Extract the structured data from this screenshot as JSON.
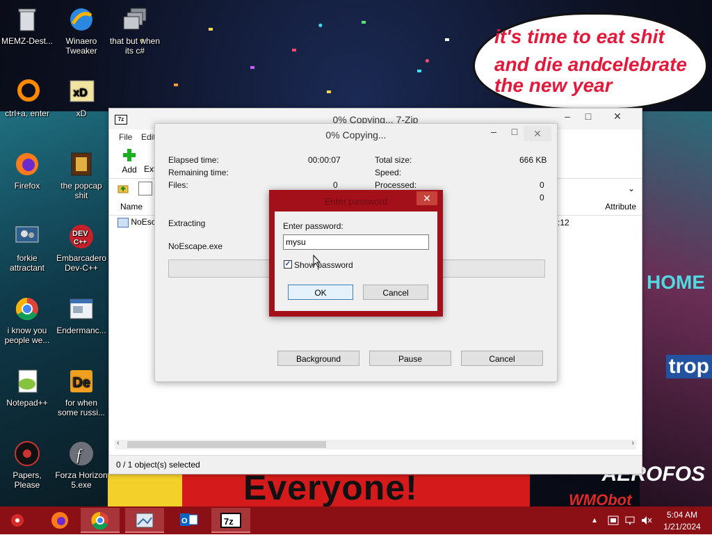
{
  "desktop": {
    "icons": [
      {
        "label": "MEMZ-Dest...",
        "icon": "recycle-bin-icon"
      },
      {
        "label": "Winaero Tweaker",
        "icon": "winaero-icon"
      },
      {
        "label": "that but when its c#",
        "icon": "stacked-windows-icon"
      },
      {
        "label": "ctrl+a, enter",
        "icon": "orange-ring-icon"
      },
      {
        "label": "xD",
        "icon": "hxd-icon"
      },
      {
        "label": "Firefox",
        "icon": "firefox-icon"
      },
      {
        "label": "the popcap shit",
        "icon": "popcap-icon"
      },
      {
        "label": "forkie attractant",
        "icon": "monitor-gears-icon"
      },
      {
        "label": "Embarcadero Dev-C++",
        "icon": "devcpp-icon"
      },
      {
        "label": "i know you people we...",
        "icon": "chrome-icon"
      },
      {
        "label": "Endermanc...",
        "icon": "document-window-icon"
      },
      {
        "label": "Notepad++",
        "icon": "notepadpp-icon"
      },
      {
        "label": "for when some russi...",
        "icon": "de-icon"
      },
      {
        "label": "Papers, Please",
        "icon": "papers-please-icon"
      },
      {
        "label": "Forza Horizon 5.exe",
        "icon": "flash-icon"
      }
    ],
    "bubble_lines": [
      "it's time to eat shit",
      "and die and",
      "celebrate",
      "the new year"
    ],
    "banner_text": "Everyone!",
    "corner_text": "AEROFOS",
    "home_text": "HOME",
    "trop_text": "trop",
    "wmo_text": "WMObot"
  },
  "zip_window": {
    "title": "0% Copying... 7-Zip",
    "menu": [
      "File",
      "Edit"
    ],
    "toolbar": {
      "add": "Add",
      "extract": "Ext"
    },
    "list_headers": {
      "name": "Name",
      "attributes": "Attribute"
    },
    "row": {
      "name": "NoEsc",
      "time_fragment": ":12"
    },
    "status": "0 / 1 object(s) selected"
  },
  "progress": {
    "title": "0% Copying...",
    "elapsed_label": "Elapsed time:",
    "elapsed_value": "00:00:07",
    "remaining_label": "Remaining time:",
    "files_label": "Files:",
    "files_value": "0",
    "total_size_label": "Total size:",
    "total_size_value": "666 KB",
    "speed_label": "Speed:",
    "processed_label": "Processed:",
    "processed_value": "0",
    "extra_value": "0",
    "action": "Extracting",
    "file": "NoEscape.exe",
    "progress_fraction": 0,
    "buttons": {
      "background": "Background",
      "pause": "Pause",
      "cancel": "Cancel"
    }
  },
  "password": {
    "title": "Enter password",
    "label": "Enter password:",
    "value": "mysu",
    "show_label": "Show password",
    "show_checked": true,
    "ok": "OK",
    "cancel": "Cancel"
  },
  "taskbar": {
    "apps": [
      "start-icon",
      "firefox-icon",
      "chrome-icon",
      "network-image-icon",
      "outlook-icon",
      "7zip-icon"
    ],
    "time": "5:04 AM",
    "date": "1/21/2024"
  },
  "colors": {
    "taskbar": "#8b1016",
    "dialog_frame": "#a4101a",
    "bubble_text": "#e3193b"
  }
}
